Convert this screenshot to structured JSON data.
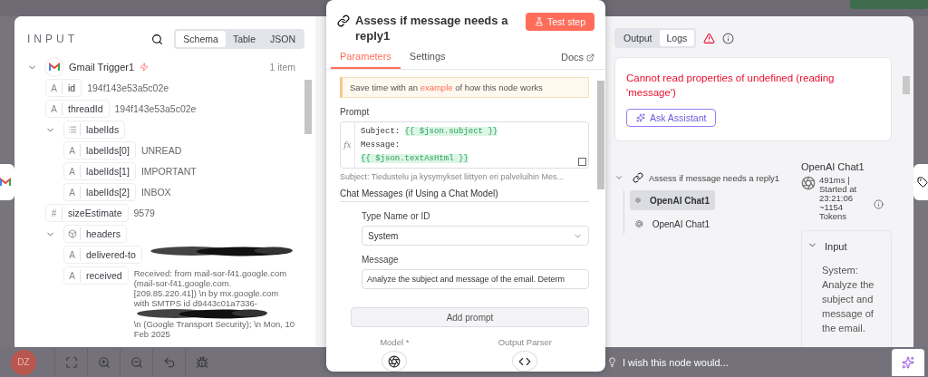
{
  "canvas": {
    "avatar_initials": "DZ",
    "feedback_prompt": "I wish this node would..."
  },
  "input_panel": {
    "title": "INPUT",
    "views": [
      {
        "label": "Schema",
        "selected": true
      },
      {
        "label": "Table",
        "selected": false
      },
      {
        "label": "JSON",
        "selected": false
      }
    ],
    "source": {
      "name": "Gmail Trigger1",
      "count": "1 item",
      "expanded": true,
      "children": [
        {
          "kind": "string",
          "glyph": "A",
          "key": "id",
          "value": "194f143e53a5c02e"
        },
        {
          "kind": "string",
          "glyph": "A",
          "key": "threadId",
          "value": "194f143e53a5c02e"
        },
        {
          "kind": "array",
          "key": "labelIds",
          "expanded": true,
          "children": [
            {
              "kind": "string",
              "glyph": "A",
              "key": "labelIds[0]",
              "value": "UNREAD"
            },
            {
              "kind": "string",
              "glyph": "A",
              "key": "labelIds[1]",
              "value": "IMPORTANT"
            },
            {
              "kind": "string",
              "glyph": "A",
              "key": "labelIds[2]",
              "value": "INBOX"
            }
          ]
        },
        {
          "kind": "number",
          "glyph": "#",
          "key": "sizeEstimate",
          "value": "9579"
        },
        {
          "kind": "object",
          "key": "headers",
          "expanded": true,
          "children": [
            {
              "kind": "string",
              "glyph": "A",
              "key": "delivered-to",
              "redacted": true
            },
            {
              "kind": "string",
              "glyph": "A",
              "key": "received",
              "value": "Received: from mail-sor-f41.google.com (mail-sor-f41.google.com. [209.85.220.41]) \\n by mx.google.com with SMTPS id d9443c01a7336-",
              "redacted": true,
              "value_after": "\\n (Google Transport Security); \\n Mon, 10 Feb 2025"
            }
          ]
        }
      ]
    }
  },
  "node_panel": {
    "title": "Assess if message needs a reply1",
    "test_button": "Test step",
    "tabs": [
      {
        "label": "Parameters",
        "selected": true
      },
      {
        "label": "Settings",
        "selected": false
      }
    ],
    "docs_link": "Docs",
    "callout": {
      "before": "Save time with an ",
      "link": "example",
      "after": " of how this node works"
    },
    "prompt": {
      "label": "Prompt",
      "fx_label": "fx",
      "lines": [
        [
          {
            "text": "Subject: ",
            "kind": "plain"
          },
          {
            "text": "{{ $json.subject }}",
            "kind": "expr"
          }
        ],
        [
          {
            "text": "Message:",
            "kind": "plain"
          }
        ],
        [
          {
            "text": "{{ $json.textAsHtml }}",
            "kind": "expr"
          }
        ]
      ],
      "hint": "Subject: Tiedustelu ja kysymykset liittyen eri palveluihin Mes..."
    },
    "chat_section": "Chat Messages (if Using a Chat Model)",
    "type_field": {
      "label": "Type Name or ID",
      "value": "System"
    },
    "message_field": {
      "label": "Message",
      "value": "Analyze the subject and message of the email. Determ"
    },
    "add_button": "Add prompt",
    "connectors": [
      {
        "label": "Model *",
        "kind": "model"
      },
      {
        "label": "Output Parser",
        "kind": "parser"
      }
    ]
  },
  "output_panel": {
    "tabs": [
      {
        "label": "Output",
        "selected": false
      },
      {
        "label": "Logs",
        "selected": true
      }
    ],
    "error": {
      "message": "Cannot read properties of undefined (reading 'message')",
      "assist_button": "Ask Assistant"
    },
    "log_tree": {
      "name": "Assess if message needs a reply1",
      "expanded": true,
      "children": [
        {
          "name": "OpenAI Chat1",
          "selected": true
        },
        {
          "name": "OpenAI Chat1",
          "selected": false
        }
      ]
    },
    "detail": {
      "title": "OpenAI Chat1",
      "duration": "491ms |",
      "started": "Started at 23:21:06",
      "tokens": "~1154 Tokens",
      "input": {
        "label": "Input",
        "expanded": true,
        "text": "System: Analyze the subject and message of the email."
      }
    }
  }
}
